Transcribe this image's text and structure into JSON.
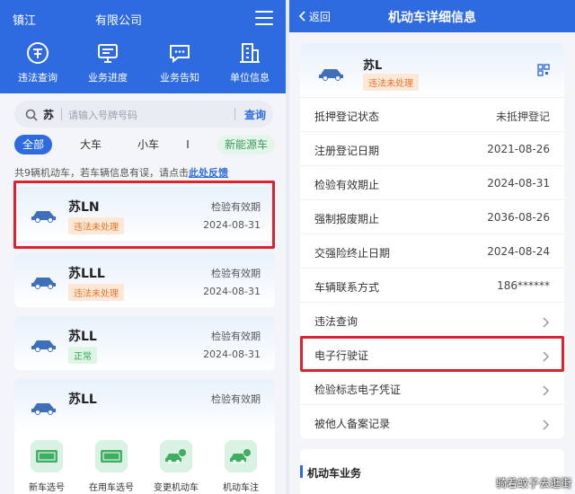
{
  "left": {
    "header": {
      "city": "镇江",
      "company": "有限公司"
    },
    "quick_actions": [
      {
        "label": "违法查询",
        "icon": "traffic-violation-icon"
      },
      {
        "label": "业务进度",
        "icon": "monitor-icon"
      },
      {
        "label": "业务告知",
        "icon": "message-icon"
      },
      {
        "label": "单位信息",
        "icon": "building-icon"
      }
    ],
    "search": {
      "province": "苏",
      "placeholder": "请输入号牌号码",
      "button": "查询"
    },
    "filters": [
      "全部",
      "大车",
      "小车",
      "I",
      "新能源车"
    ],
    "info": {
      "text": "共9辆机动车，若车辆信息有误，请点击",
      "link": "此处反馈"
    },
    "vehicles": [
      {
        "plate": "苏LN",
        "status": "违法未处理",
        "label": "检验有效期",
        "date": "2024-08-31"
      },
      {
        "plate": "苏LLL",
        "status": "违法未处理",
        "label": "检验有效期",
        "date": "2024-08-31"
      },
      {
        "plate": "苏LL",
        "status": "正常",
        "label": "检验有效期",
        "date": "2024-08-31"
      },
      {
        "plate": "苏LL",
        "status": "",
        "label": "检验有效期",
        "date": ""
      }
    ],
    "bottom_items": [
      {
        "label": "新车选号"
      },
      {
        "label": "在用车选号"
      },
      {
        "label": "变更机动车"
      },
      {
        "label": "机动车注"
      }
    ]
  },
  "right": {
    "back": "返回",
    "title": "机动车详细信息",
    "vehicle": {
      "plate": "苏L",
      "status": "违法未处理"
    },
    "rows": [
      {
        "label": "抵押登记状态",
        "value": "未抵押登记"
      },
      {
        "label": "注册登记日期",
        "value": "2021-08-26"
      },
      {
        "label": "检验有效期止",
        "value": "2024-08-31"
      },
      {
        "label": "强制报废期止",
        "value": "2036-08-26"
      },
      {
        "label": "交强险终止日期",
        "value": "2024-08-24"
      },
      {
        "label": "车辆联系方式",
        "value": "186******"
      },
      {
        "label": "违法查询",
        "value": ""
      },
      {
        "label": "电子行驶证",
        "value": ""
      },
      {
        "label": "检验标志电子凭证",
        "value": ""
      },
      {
        "label": "被他人备案记录",
        "value": ""
      }
    ],
    "section_title": "机动车业务"
  },
  "watermark": "骑着蚊子去逛街",
  "colors": {
    "primary": "#2f6be0",
    "highlight": "#d9232e",
    "warn": "#e4742a",
    "ok": "#35a359"
  }
}
